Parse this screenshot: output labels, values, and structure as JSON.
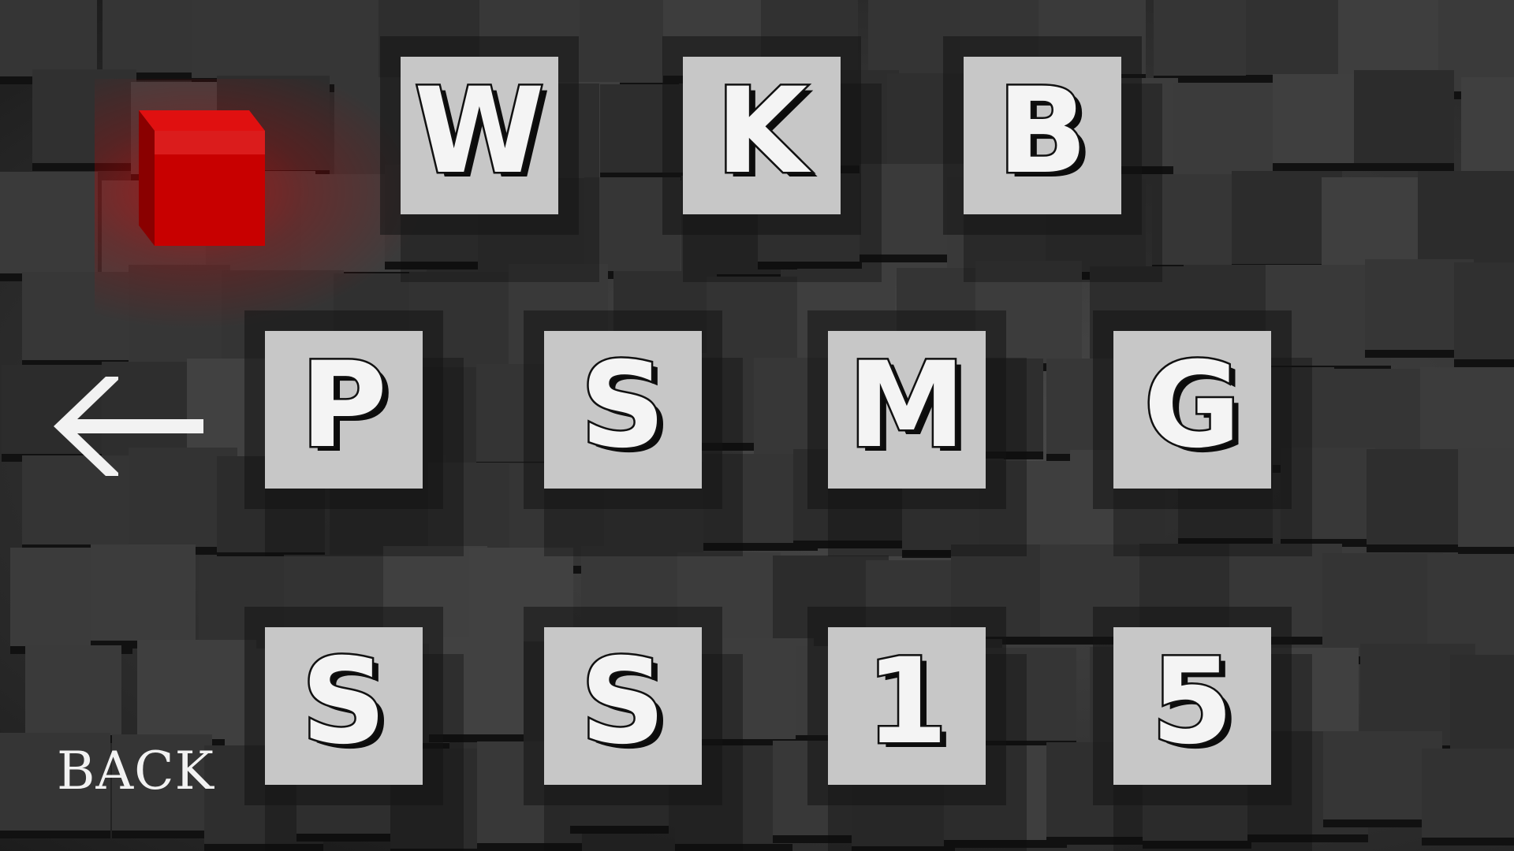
{
  "screen": {
    "back_label": "BACK",
    "accent_color": "#e00000",
    "tile_color": "#c7c7c7"
  },
  "levels": [
    {
      "glyph": "W"
    },
    {
      "glyph": "K"
    },
    {
      "glyph": "B"
    },
    {
      "glyph": "P"
    },
    {
      "glyph": "S"
    },
    {
      "glyph": "M"
    },
    {
      "glyph": "G"
    },
    {
      "glyph": "S"
    },
    {
      "glyph": "S"
    },
    {
      "glyph": "1"
    },
    {
      "glyph": "5"
    }
  ],
  "icons": {
    "back": "left-arrow-icon",
    "cursor": "red-cube-icon"
  }
}
